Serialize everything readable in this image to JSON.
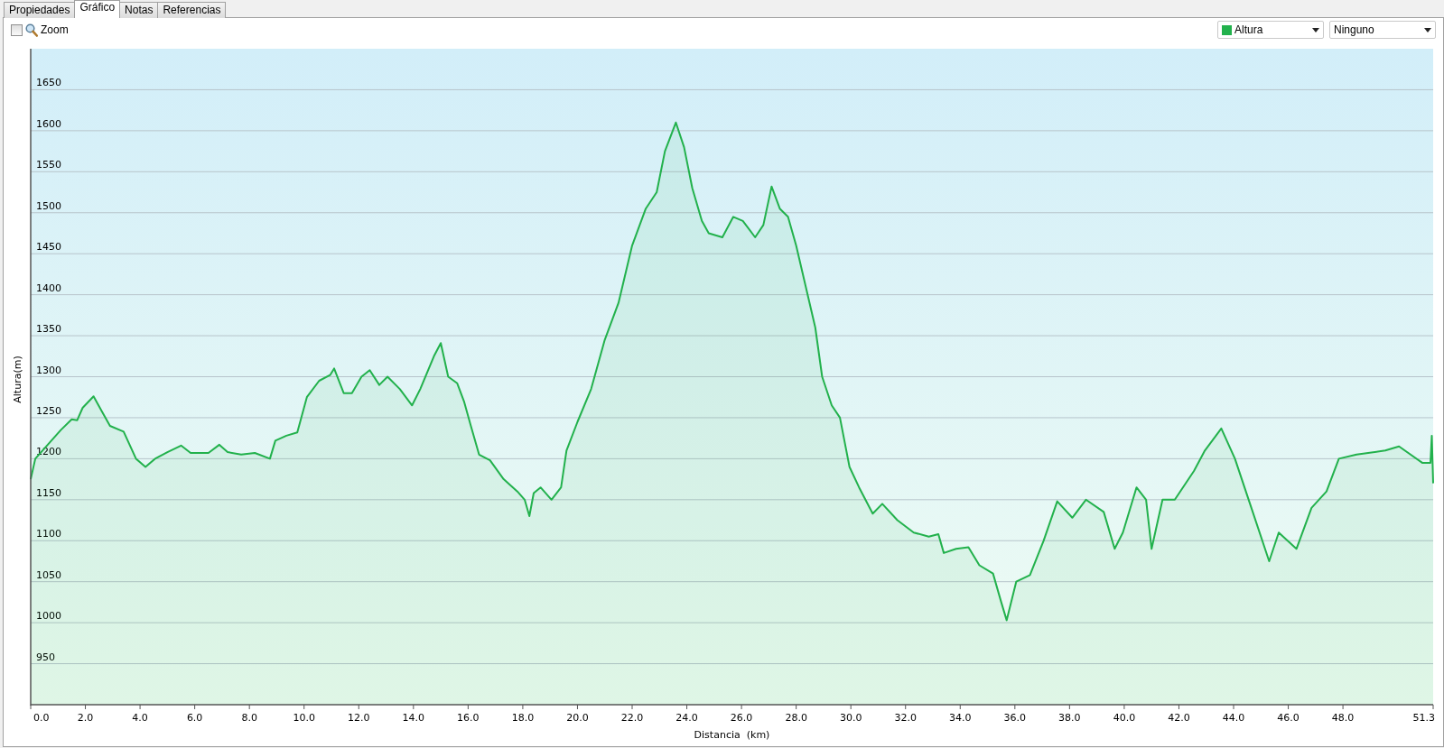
{
  "tabs": [
    {
      "label": "Propiedades",
      "selected": false
    },
    {
      "label": "Gráfico",
      "selected": true
    },
    {
      "label": "Notas",
      "selected": false
    },
    {
      "label": "Referencias",
      "selected": false
    }
  ],
  "toolbar": {
    "zoom": {
      "label": "Zoom",
      "checked": false
    },
    "compare_select": {
      "value": "Ninguno"
    }
  },
  "chart": {
    "chart_data": {
      "type": "area",
      "grid": true,
      "xlabel": "Distancia  (km)",
      "ylabel": "Altura(m)",
      "x": [
        0,
        0.17,
        0.57,
        1.1,
        1.5,
        1.7,
        1.9,
        2.3,
        2.6,
        2.9,
        3.4,
        3.85,
        4.2,
        4.55,
        5.0,
        5.5,
        5.85,
        6.5,
        6.9,
        7.2,
        7.7,
        8.2,
        8.75,
        8.95,
        9.35,
        9.75,
        10.1,
        10.55,
        10.95,
        11.1,
        11.45,
        11.75,
        12.1,
        12.4,
        12.75,
        13.05,
        13.5,
        13.95,
        14.25,
        14.75,
        15.0,
        15.27,
        15.6,
        15.85,
        16.1,
        16.4,
        16.8,
        17.3,
        17.8,
        18.07,
        18.24,
        18.4,
        18.65,
        19.05,
        19.4,
        19.6,
        20.0,
        20.5,
        21.0,
        21.5,
        22.0,
        22.5,
        22.9,
        23.2,
        23.6,
        23.9,
        24.2,
        24.55,
        24.8,
        25.3,
        25.7,
        26.05,
        26.5,
        26.8,
        27.1,
        27.4,
        27.7,
        28.0,
        28.35,
        28.7,
        28.95,
        29.3,
        29.6,
        29.95,
        30.3,
        30.8,
        31.15,
        31.7,
        32.3,
        32.85,
        33.2,
        33.4,
        33.85,
        34.3,
        34.7,
        35.2,
        35.5,
        35.7,
        36.05,
        36.55,
        37.05,
        37.55,
        38.1,
        38.6,
        39.25,
        39.65,
        39.95,
        40.45,
        40.8,
        41.0,
        41.4,
        41.85,
        42.55,
        42.95,
        43.55,
        44.05,
        44.65,
        45.3,
        45.65,
        46.3,
        46.85,
        47.4,
        47.85,
        48.5,
        49.55,
        50.05,
        50.9,
        51.2,
        51.25,
        51.3
      ],
      "series": [
        {
          "name": "Altura",
          "color": "#22b14c",
          "values": [
            1175,
            1200,
            1215,
            1235,
            1248,
            1247,
            1262,
            1276,
            1258,
            1240,
            1233,
            1200,
            1190,
            1200,
            1208,
            1216,
            1207,
            1207,
            1217,
            1208,
            1205,
            1207,
            1200,
            1222,
            1228,
            1232,
            1275,
            1295,
            1302,
            1310,
            1280,
            1280,
            1300,
            1308,
            1290,
            1300,
            1285,
            1265,
            1285,
            1325,
            1341,
            1300,
            1292,
            1270,
            1240,
            1205,
            1198,
            1175,
            1160,
            1150,
            1130,
            1158,
            1165,
            1150,
            1165,
            1210,
            1245,
            1285,
            1345,
            1390,
            1460,
            1505,
            1525,
            1575,
            1610,
            1580,
            1530,
            1490,
            1475,
            1470,
            1495,
            1490,
            1470,
            1485,
            1532,
            1505,
            1495,
            1460,
            1410,
            1360,
            1300,
            1265,
            1250,
            1190,
            1165,
            1133,
            1145,
            1125,
            1110,
            1105,
            1108,
            1085,
            1090,
            1092,
            1070,
            1060,
            1025,
            1003,
            1050,
            1058,
            1100,
            1148,
            1128,
            1150,
            1135,
            1090,
            1110,
            1165,
            1150,
            1090,
            1150,
            1150,
            1185,
            1210,
            1237,
            1200,
            1140,
            1075,
            1110,
            1090,
            1140,
            1160,
            1200,
            1205,
            1210,
            1215,
            1195,
            1195,
            1228,
            1170
          ]
        }
      ],
      "xlim": [
        0,
        51.3
      ],
      "ylim": [
        900,
        1700
      ],
      "xticks": [
        {
          "value": 0,
          "label": "0.0"
        },
        {
          "value": 2,
          "label": "2.0"
        },
        {
          "value": 4,
          "label": "4.0"
        },
        {
          "value": 6,
          "label": "6.0"
        },
        {
          "value": 8,
          "label": "8.0"
        },
        {
          "value": 10,
          "label": "10.0"
        },
        {
          "value": 12,
          "label": "12.0"
        },
        {
          "value": 14,
          "label": "14.0"
        },
        {
          "value": 16,
          "label": "16.0"
        },
        {
          "value": 18,
          "label": "18.0"
        },
        {
          "value": 20,
          "label": "20.0"
        },
        {
          "value": 22,
          "label": "22.0"
        },
        {
          "value": 24,
          "label": "24.0"
        },
        {
          "value": 26,
          "label": "26.0"
        },
        {
          "value": 28,
          "label": "28.0"
        },
        {
          "value": 30,
          "label": "30.0"
        },
        {
          "value": 32,
          "label": "32.0"
        },
        {
          "value": 34,
          "label": "34.0"
        },
        {
          "value": 36,
          "label": "36.0"
        },
        {
          "value": 38,
          "label": "38.0"
        },
        {
          "value": 40,
          "label": "40.0"
        },
        {
          "value": 42,
          "label": "42.0"
        },
        {
          "value": 44,
          "label": "44.0"
        },
        {
          "value": 46,
          "label": "46.0"
        },
        {
          "value": 48,
          "label": "48.0"
        },
        {
          "value": 51.3,
          "label": "51.3"
        }
      ],
      "yticks": [
        950,
        1000,
        1050,
        1100,
        1150,
        1200,
        1250,
        1300,
        1350,
        1400,
        1450,
        1500,
        1550,
        1600,
        1650
      ]
    }
  }
}
